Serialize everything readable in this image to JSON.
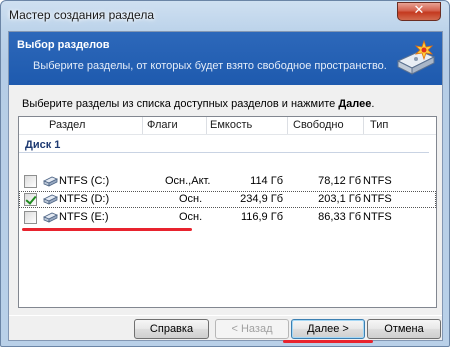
{
  "window": {
    "title": "Мастер создания раздела",
    "close_symbol": "✕"
  },
  "banner": {
    "title": "Выбор разделов",
    "subtitle": "Выберите разделы, от которых будет взято свободное пространство.",
    "icon": "partition-wizard-icon"
  },
  "instruction": {
    "text": "Выберите разделы из списка доступных разделов и нажмите ",
    "bold": "Далее",
    "tail": "."
  },
  "table": {
    "headers": [
      "Раздел",
      "Флаги",
      "Емкость",
      "Свободно",
      "Тип"
    ],
    "group": "Диск 1",
    "rows": [
      {
        "checked": false,
        "name": "NTFS (C:)",
        "flags": "Осн.,Акт.",
        "capacity": "114 Гб",
        "free": "78,12 Гб",
        "type": "NTFS"
      },
      {
        "checked": true,
        "name": "NTFS (D:)",
        "flags": "Осн.",
        "capacity": "234,9 Гб",
        "free": "203,1 Гб",
        "type": "NTFS"
      },
      {
        "checked": false,
        "name": "NTFS (E:)",
        "flags": "Осн.",
        "capacity": "116,9 Гб",
        "free": "86,33 Гб",
        "type": "NTFS"
      }
    ]
  },
  "buttons": {
    "help": "Справка",
    "back": "< Назад",
    "next": "Далее >",
    "cancel": "Отмена"
  },
  "colors": {
    "banner": "#1e5aae",
    "highlight_underline": "#e8232e",
    "check": "#1f8a1f"
  }
}
